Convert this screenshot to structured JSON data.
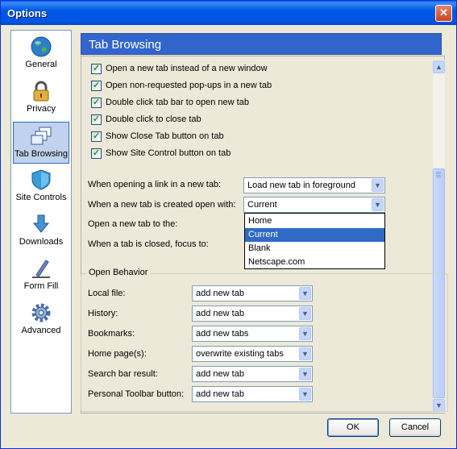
{
  "window": {
    "title": "Options",
    "close_glyph": "✕"
  },
  "sidebar": {
    "items": [
      {
        "label": "General",
        "icon": "globe-icon"
      },
      {
        "label": "Privacy",
        "icon": "padlock-icon"
      },
      {
        "label": "Tab Browsing",
        "icon": "tabs-icon",
        "selected": true
      },
      {
        "label": "Site Controls",
        "icon": "shield-icon"
      },
      {
        "label": "Downloads",
        "icon": "download-arrow-icon"
      },
      {
        "label": "Form Fill",
        "icon": "pen-icon"
      },
      {
        "label": "Advanced",
        "icon": "gear-icon"
      }
    ]
  },
  "header": {
    "title": "Tab Browsing"
  },
  "checkboxes": [
    {
      "label": "Open a new tab instead of a new window",
      "checked": true
    },
    {
      "label": "Open non-requested pop-ups in a new tab",
      "checked": true
    },
    {
      "label": "Double click tab bar to open new tab",
      "checked": true
    },
    {
      "label": "Double click to close tab",
      "checked": true
    },
    {
      "label": "Show Close Tab button on tab",
      "checked": true
    },
    {
      "label": "Show Site Control button on tab",
      "checked": true
    }
  ],
  "check_glyph": "✓",
  "settings": [
    {
      "label": "When opening a link in a new tab:",
      "value": "Load new tab in foreground"
    },
    {
      "label": "When a new tab is created open with:",
      "value": "Current"
    },
    {
      "label": "Open a new tab to the:",
      "value": ""
    },
    {
      "label": "When a tab is closed, focus to:",
      "value": ""
    }
  ],
  "dropdown": {
    "options": [
      "Home",
      "Current",
      "Blank",
      "Netscape.com"
    ],
    "selected": "Current"
  },
  "open_behavior": {
    "title": "Open Behavior",
    "rows": [
      {
        "label": "Local file:",
        "value": "add new tab"
      },
      {
        "label": "History:",
        "value": "add new tab"
      },
      {
        "label": "Bookmarks:",
        "value": "add new tabs"
      },
      {
        "label": "Home page(s):",
        "value": "overwrite existing tabs"
      },
      {
        "label": "Search bar result:",
        "value": "add new tab"
      },
      {
        "label": "Personal Toolbar button:",
        "value": "add new tab"
      }
    ]
  },
  "buttons": {
    "ok": "OK",
    "cancel": "Cancel"
  },
  "glyphs": {
    "arrow_down": "▼",
    "arrow_up": "▲"
  }
}
